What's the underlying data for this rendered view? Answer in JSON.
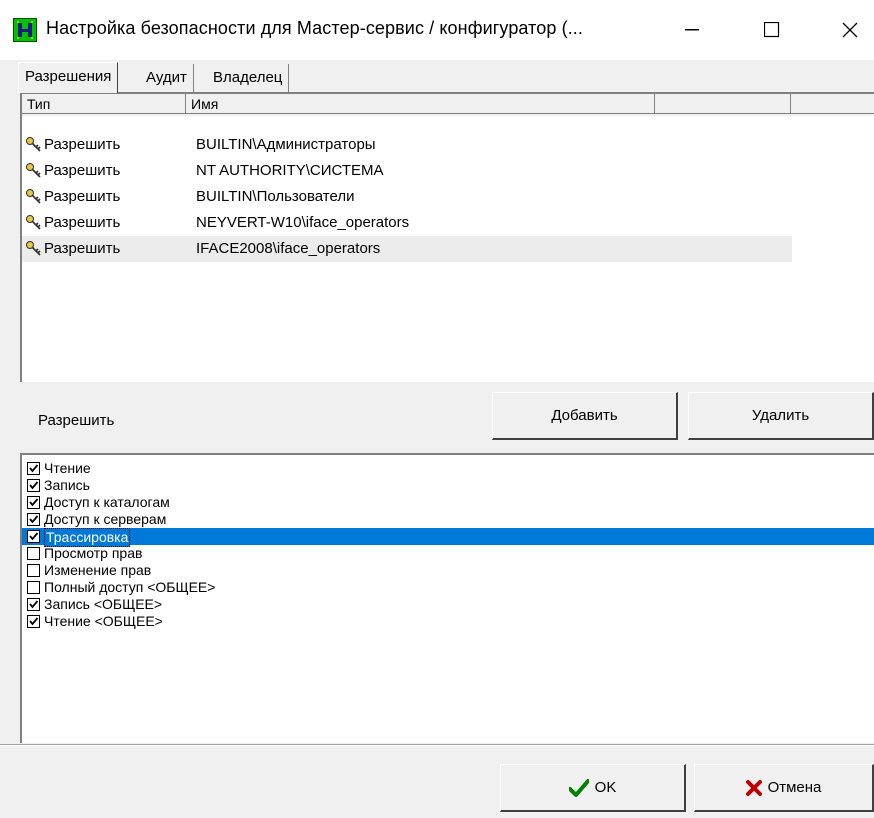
{
  "window": {
    "title": "Настройка безопасности для Мастер-сервис / конфигуратор  (...",
    "minimize_icon": "minimize-icon",
    "maximize_icon": "maximize-icon",
    "close_icon": "close-icon"
  },
  "tabs": [
    {
      "label": "Разрешения",
      "active": true
    },
    {
      "label": "Аудит",
      "active": false
    },
    {
      "label": "Владелец",
      "active": false
    }
  ],
  "acl_list": {
    "columns": [
      "Тип",
      "Имя",
      "",
      ""
    ],
    "rows": [
      {
        "type": "Разрешить",
        "name": "BUILTIN\\Администраторы",
        "icon": "key-icon"
      },
      {
        "type": "Разрешить",
        "name": "NT AUTHORITY\\СИСТЕМА",
        "icon": "key-icon"
      },
      {
        "type": "Разрешить",
        "name": "BUILTIN\\Пользователи",
        "icon": "key-icon"
      },
      {
        "type": "Разрешить",
        "name": "NEYVERT-W10\\iface_operators",
        "icon": "key-icon"
      },
      {
        "type": "Разрешить",
        "name": "IFACE2008\\iface_operators",
        "icon": "key-icon",
        "selected": true
      }
    ]
  },
  "permission_section": {
    "label": "Разрешить",
    "add_button": "Добавить",
    "remove_button": "Удалить"
  },
  "permissions": [
    {
      "label": "Чтение",
      "checked": true
    },
    {
      "label": "Запись",
      "checked": true
    },
    {
      "label": "Доступ к каталогам",
      "checked": true
    },
    {
      "label": "Доступ к серверам",
      "checked": true
    },
    {
      "label": "Трассировка",
      "checked": true,
      "selected": true
    },
    {
      "label": "Просмотр прав",
      "checked": false
    },
    {
      "label": "Изменение прав",
      "checked": false
    },
    {
      "label": "Полный доступ <ОБЩЕЕ>",
      "checked": false
    },
    {
      "label": "Запись <ОБЩЕЕ>",
      "checked": true
    },
    {
      "label": "Чтение <ОБЩЕЕ>",
      "checked": true
    }
  ],
  "footer": {
    "ok_label": "OK",
    "ok_icon": "checkmark-icon",
    "cancel_label": "Отмена",
    "cancel_icon": "x-icon"
  },
  "colors": {
    "selection": "#0078d7",
    "ok_green": "#008000",
    "cancel_red": "#c00000",
    "app_icon_green": "#00c000"
  }
}
